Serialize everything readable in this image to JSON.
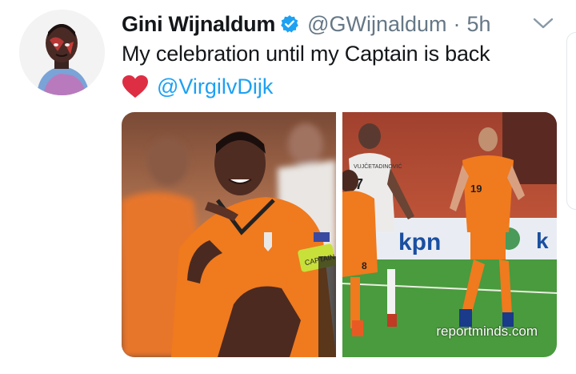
{
  "tweet": {
    "display_name": "Gini Wijnaldum",
    "handle": "@GWijnaldum",
    "separator": "·",
    "time": "5h",
    "text_line1": "My celebration until my Captain is back",
    "mention": "@VirgilvDijk",
    "icons": [
      "verified-badge-icon",
      "chevron-down-icon",
      "red-heart-emoji"
    ]
  },
  "media": {
    "watermark": "reportminds.com",
    "photo1": {
      "captain_band_text": "CAPTAIN"
    },
    "photo2": {
      "player_numbers": [
        "7",
        "8",
        "19"
      ],
      "jersey_name": "VUJČETADINOVIĆ",
      "board_text": "kpn",
      "board_text2": "k"
    }
  },
  "colors": {
    "link": "#1da1f2",
    "verified": "#1da1f2",
    "meta": "#657786",
    "orange": "#f2761d",
    "heart": "#e0245e"
  }
}
